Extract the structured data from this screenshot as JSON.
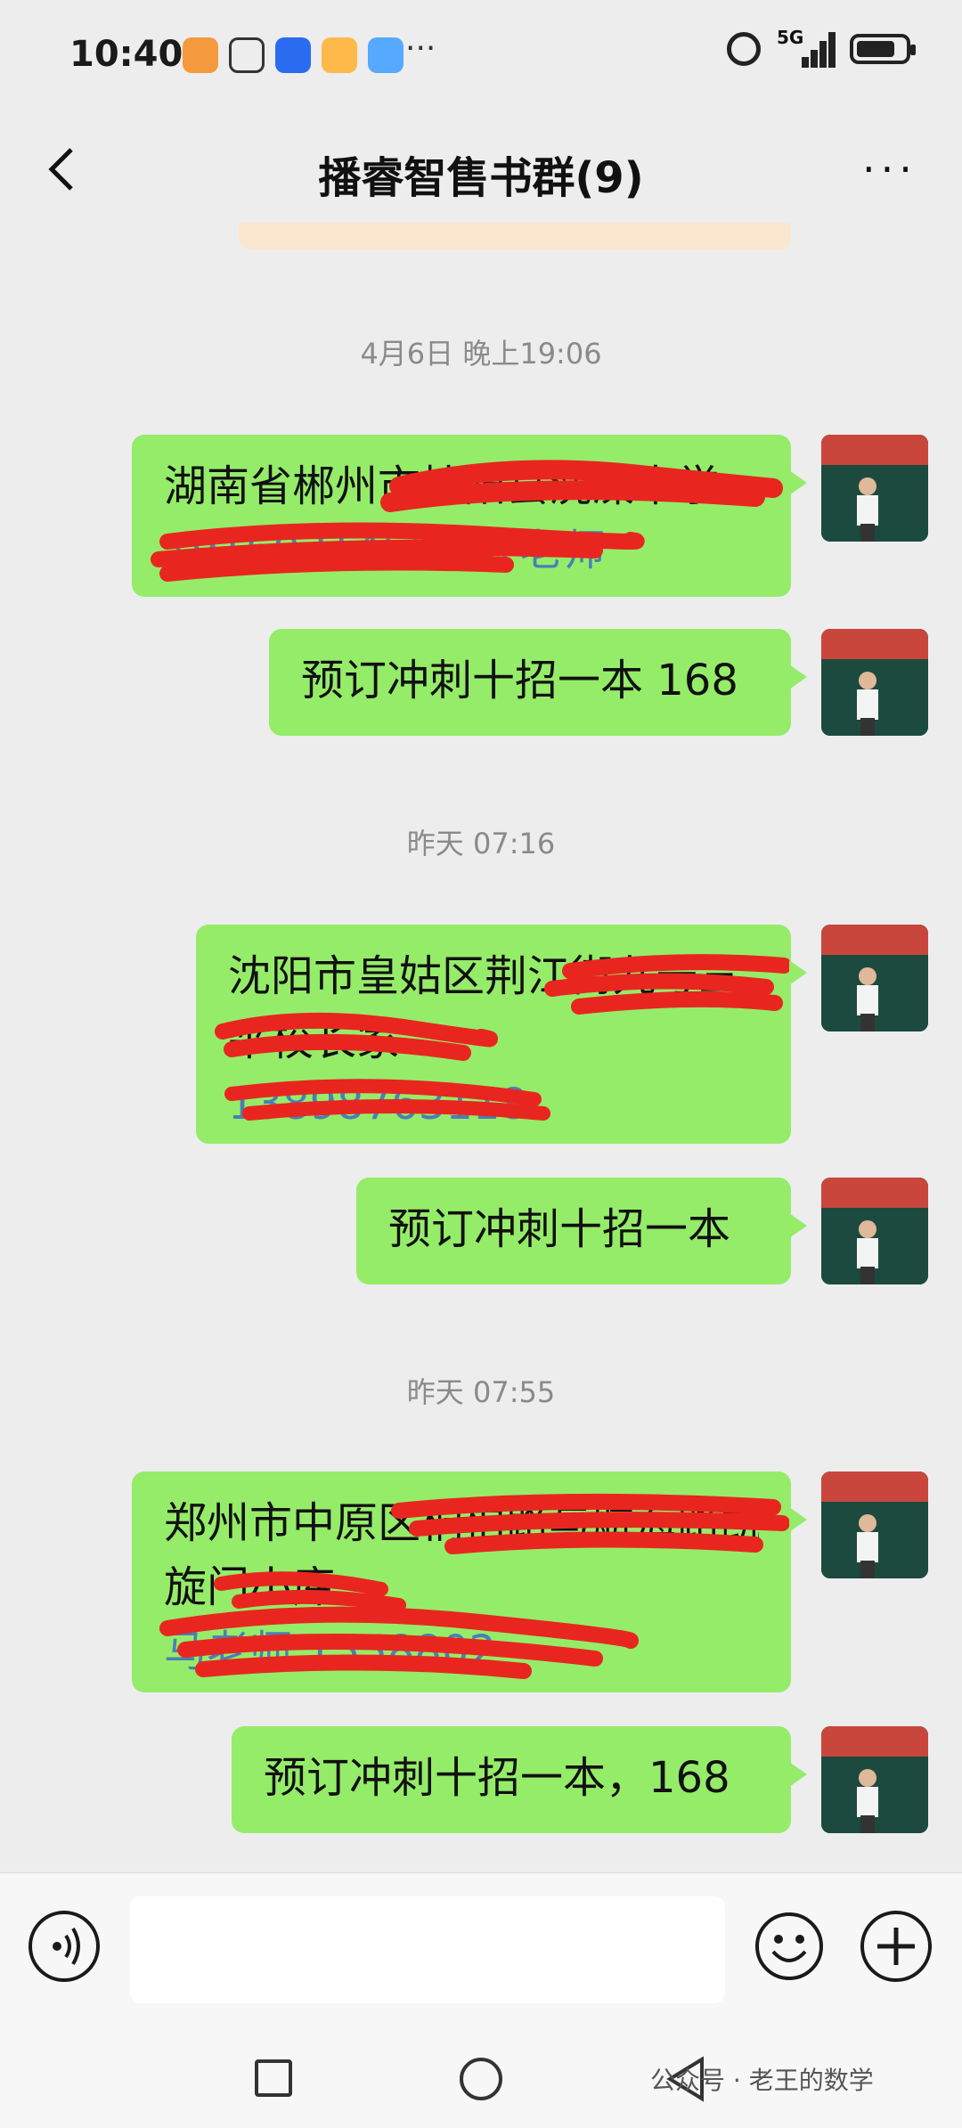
{
  "status_bar": {
    "time": "10:40",
    "network": "5G",
    "more": "···",
    "app_icon_colors": [
      "#f59a3c",
      "#ffffff",
      "#2a6cf0",
      "#ffb94a",
      "#57a8ff"
    ]
  },
  "header": {
    "title": "播睿智售书群(9)",
    "more": "···"
  },
  "timestamps": {
    "t1": "4月6日 晚上19:06",
    "t2": "昨天 07:16",
    "t3": "昨天 07:55"
  },
  "messages": {
    "m1": {
      "line1": "湖南省郴州市桂阳县洗澡中学",
      "line2": "19160314500 叶老师"
    },
    "m2": {
      "line1": "预订冲刺十招一本 168"
    },
    "m3": {
      "line1": "沈阳市皇姑区荆江街九号三",
      "line2": "平校长家",
      "line3": "13898763118"
    },
    "m4": {
      "line1": "预订冲刺十招一本"
    },
    "m5": {
      "line1": "郑州市中原区桐柏路与航海路凯",
      "line2": "旋门小库",
      "line3": "马老师 1558802"
    },
    "m6": {
      "line1": "预订冲刺十招一本，168"
    }
  },
  "input_bar": {
    "placeholder": ""
  },
  "watermark": "公众号 · 老王的数学",
  "colors": {
    "bubble": "#95ec69",
    "redaction": "#e8261f",
    "background": "#ededed"
  }
}
